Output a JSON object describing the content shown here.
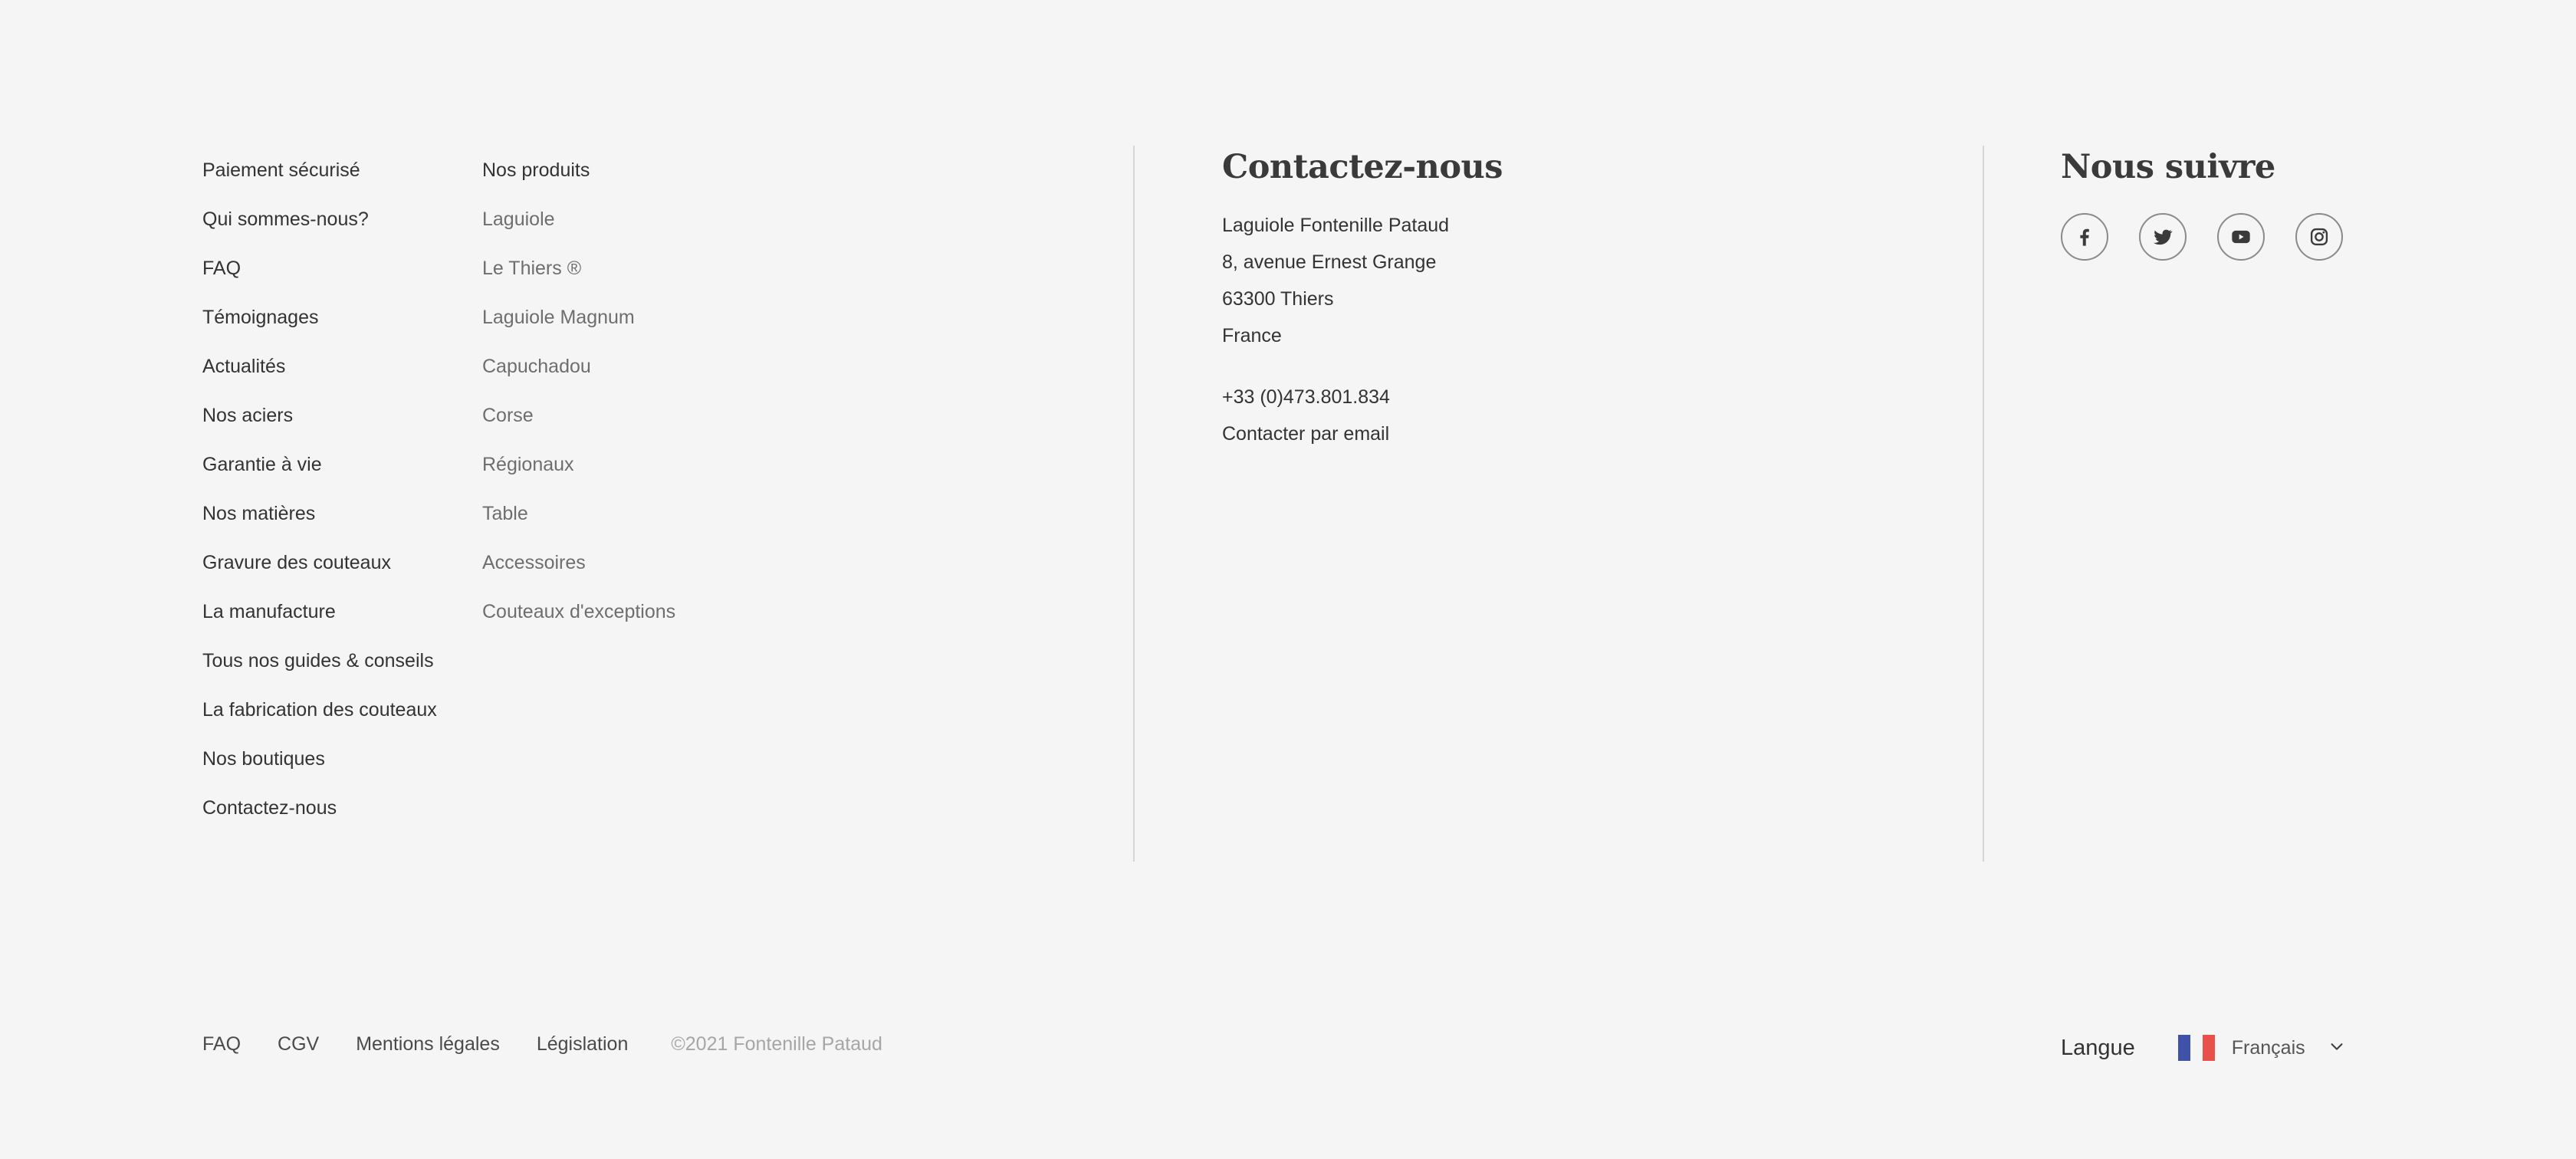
{
  "links_col_a": [
    "Paiement sécurisé",
    "Qui sommes-nous?",
    "FAQ",
    "Témoignages",
    "Actualités",
    "Nos aciers",
    "Garantie à vie",
    "Nos matières",
    "Gravure des couteaux",
    "La manufacture",
    "Tous nos guides & conseils",
    "La fabrication des couteaux",
    "Nos boutiques",
    "Contactez-nous"
  ],
  "products": {
    "heading": "Nos produits",
    "items": [
      "Laguiole",
      "Le Thiers ®",
      "Laguiole Magnum",
      "Capuchadou",
      "Corse",
      "Régionaux",
      "Table",
      "Accessoires",
      "Couteaux d'exceptions"
    ]
  },
  "contact": {
    "heading": "Contactez-nous",
    "address": [
      "Laguiole Fontenille Pataud",
      "8, avenue Ernest Grange",
      "63300 Thiers",
      "France"
    ],
    "phone": "+33 (0)473.801.834",
    "email_link": "Contacter par email"
  },
  "social": {
    "heading": "Nous suivre",
    "icons": [
      "facebook-icon",
      "twitter-icon",
      "youtube-icon",
      "instagram-icon"
    ]
  },
  "bottom": {
    "links": [
      "FAQ",
      "CGV",
      "Mentions légales",
      "Législation"
    ],
    "copyright": "©2021 Fontenille Pataud"
  },
  "language": {
    "label": "Langue",
    "value": "Français",
    "flag_colors": [
      "#3f51a8",
      "#f5f5f5",
      "#e8504c"
    ]
  }
}
